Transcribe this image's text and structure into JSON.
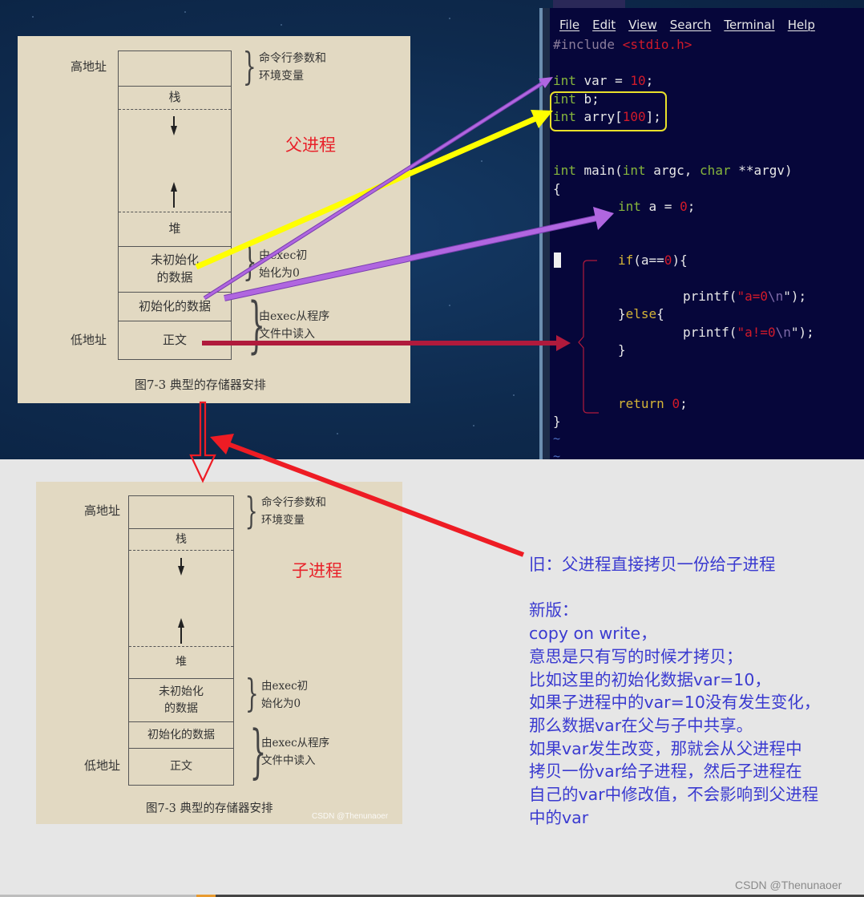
{
  "terminal": {
    "menu": [
      "File",
      "Edit",
      "View",
      "Search",
      "Terminal",
      "Help"
    ],
    "code": {
      "include": "#include",
      "include_header": "<stdio.h>",
      "line_var": {
        "type": "int",
        "rest": " var = ",
        "value": "10",
        "end": ";"
      },
      "line_b": {
        "type": "int",
        "rest": " b;"
      },
      "line_arry": {
        "type": "int",
        "rest": " arry[",
        "value": "100",
        "end": "];"
      },
      "main_sig": {
        "t1": "int",
        "p1": " main(",
        "t2": "int",
        "p2": " argc, ",
        "t3": "char",
        "p3": " **argv)"
      },
      "open_brace": "{",
      "line_a": {
        "type": "int",
        "rest": " a = ",
        "value": "0",
        "end": ";"
      },
      "if_line": {
        "kw": "if",
        "p1": "(a==",
        "value": "0",
        "p2": "){"
      },
      "printf1": {
        "fn": "printf(",
        "q": "\"",
        "s": "a=0",
        "esc": "\\n",
        "end": "\");"
      },
      "else_line": {
        "p1": "}",
        "kw": "else",
        "p2": "{"
      },
      "printf2": {
        "fn": "printf(",
        "q": "\"",
        "s": "a!=0",
        "esc": "\\n",
        "end": "\");"
      },
      "close_if": "}",
      "return_line": {
        "kw": "return",
        "value": "0",
        "end": ";"
      },
      "close_main": "}",
      "tilde": "~"
    }
  },
  "diagrams": {
    "parent": {
      "process_label": "父进程",
      "high_address": "高地址",
      "low_address": "低地址",
      "segments": {
        "stack": "栈",
        "heap": "堆",
        "bss_line1": "未初始化",
        "bss_line2": "的数据",
        "data": "初始化的数据",
        "text": "正文"
      },
      "notes": {
        "args_line1": "命令行参数和",
        "args_line2": "环境变量",
        "bss_line1": "由exec初",
        "bss_line2": "始化为0",
        "load_line1": "由exec从程序",
        "load_line2": "文件中读入"
      },
      "caption": "图7-3   典型的存储器安排"
    },
    "child": {
      "process_label": "子进程",
      "high_address": "高地址",
      "low_address": "低地址",
      "segments": {
        "stack": "栈",
        "heap": "堆",
        "bss_line1": "未初始化",
        "bss_line2": "的数据",
        "data": "初始化的数据",
        "text": "正文"
      },
      "notes": {
        "args_line1": "命令行参数和",
        "args_line2": "环境变量",
        "bss_line1": "由exec初",
        "bss_line2": "始化为0",
        "load_line1": "由exec从程序",
        "load_line2": "文件中读入"
      },
      "caption": "图7-3   典型的存储器安排",
      "watermark": "CSDN @Thenunaoer"
    }
  },
  "explanation": {
    "old": "旧：父进程直接拷贝一份给子进程",
    "new_title": "新版：",
    "lines": [
      "copy on write，",
      "意思是只有写的时候才拷贝；",
      "比如这里的初始化数据var=10，",
      "如果子进程中的var=10没有发生变化，",
      "那么数据var在父与子中共享。",
      "如果var发生改变，那就会从父进程中",
      "拷贝一份var给子进程，然后子进程在",
      "自己的var中修改值，不会影响到父进程",
      "中的var"
    ]
  },
  "annotation_colors": {
    "yellow": "#ffff00",
    "purple": "#b066e0",
    "crimson": "#b01a3c",
    "red": "#ee1c24",
    "note_text": "#3a3ad0"
  },
  "watermark": "CSDN @Thenunaoer"
}
